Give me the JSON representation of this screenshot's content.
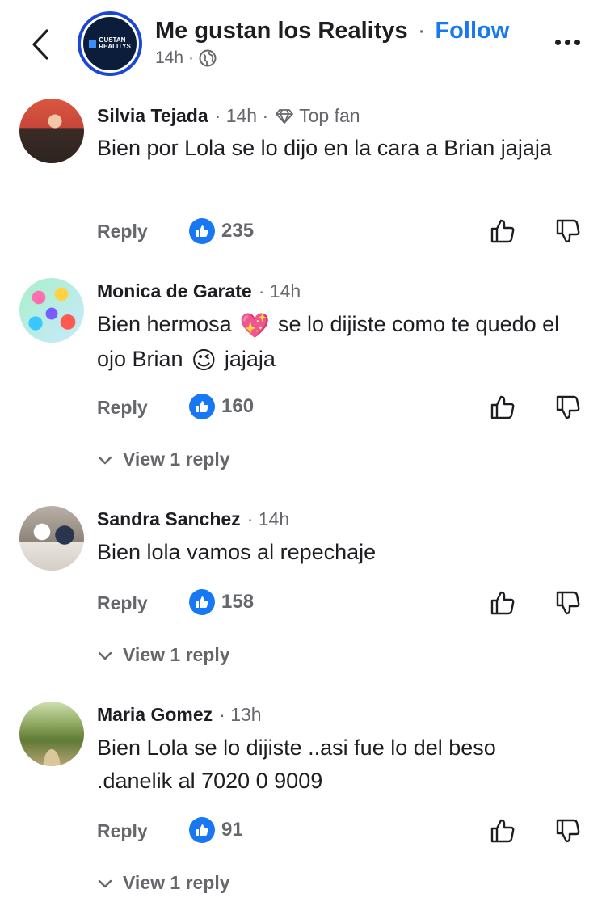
{
  "header": {
    "page_name": "Me gustan los Realitys",
    "separator": "·",
    "follow_label": "Follow",
    "time": "14h",
    "meta_separator": "·",
    "avatar_text_line1": "GUSTAN",
    "avatar_text_line2": "REALITYS",
    "icons": {
      "back": "chevron-left-icon",
      "privacy": "globe-icon",
      "more": "more-dots-icon"
    }
  },
  "comments": [
    {
      "author": "Silvia Tejada",
      "time": "· 14h ·",
      "badge": "Top fan",
      "text": "Bien por Lola se lo dijo en la cara a Brian jajaja",
      "reply_label": "Reply",
      "likes": "235"
    },
    {
      "author": "Monica de Garate",
      "time": "· 14h",
      "text_part1": "Bien hermosa",
      "emoji1": "💖",
      "text_part2": "se lo dijiste  como te quedo el ojo Brian",
      "emoji2": "😉",
      "text_part3": "jajaja",
      "reply_label": "Reply",
      "likes": "160",
      "view_replies": "View 1 reply"
    },
    {
      "author": "Sandra Sanchez",
      "time": "· 14h",
      "text": "Bien lola vamos al repechaje",
      "reply_label": "Reply",
      "likes": "158",
      "view_replies": "View 1 reply"
    },
    {
      "author": "Maria Gomez",
      "time": "· 13h",
      "text": "Bien Lola  se lo dijiste ..asi fue lo del beso .danelik al 7020 0 9009",
      "reply_label": "Reply",
      "likes": "91",
      "view_replies": "View 1 reply"
    }
  ],
  "colors": {
    "accent": "#1877f2",
    "muted": "#65676b",
    "text": "#1c1e21"
  }
}
